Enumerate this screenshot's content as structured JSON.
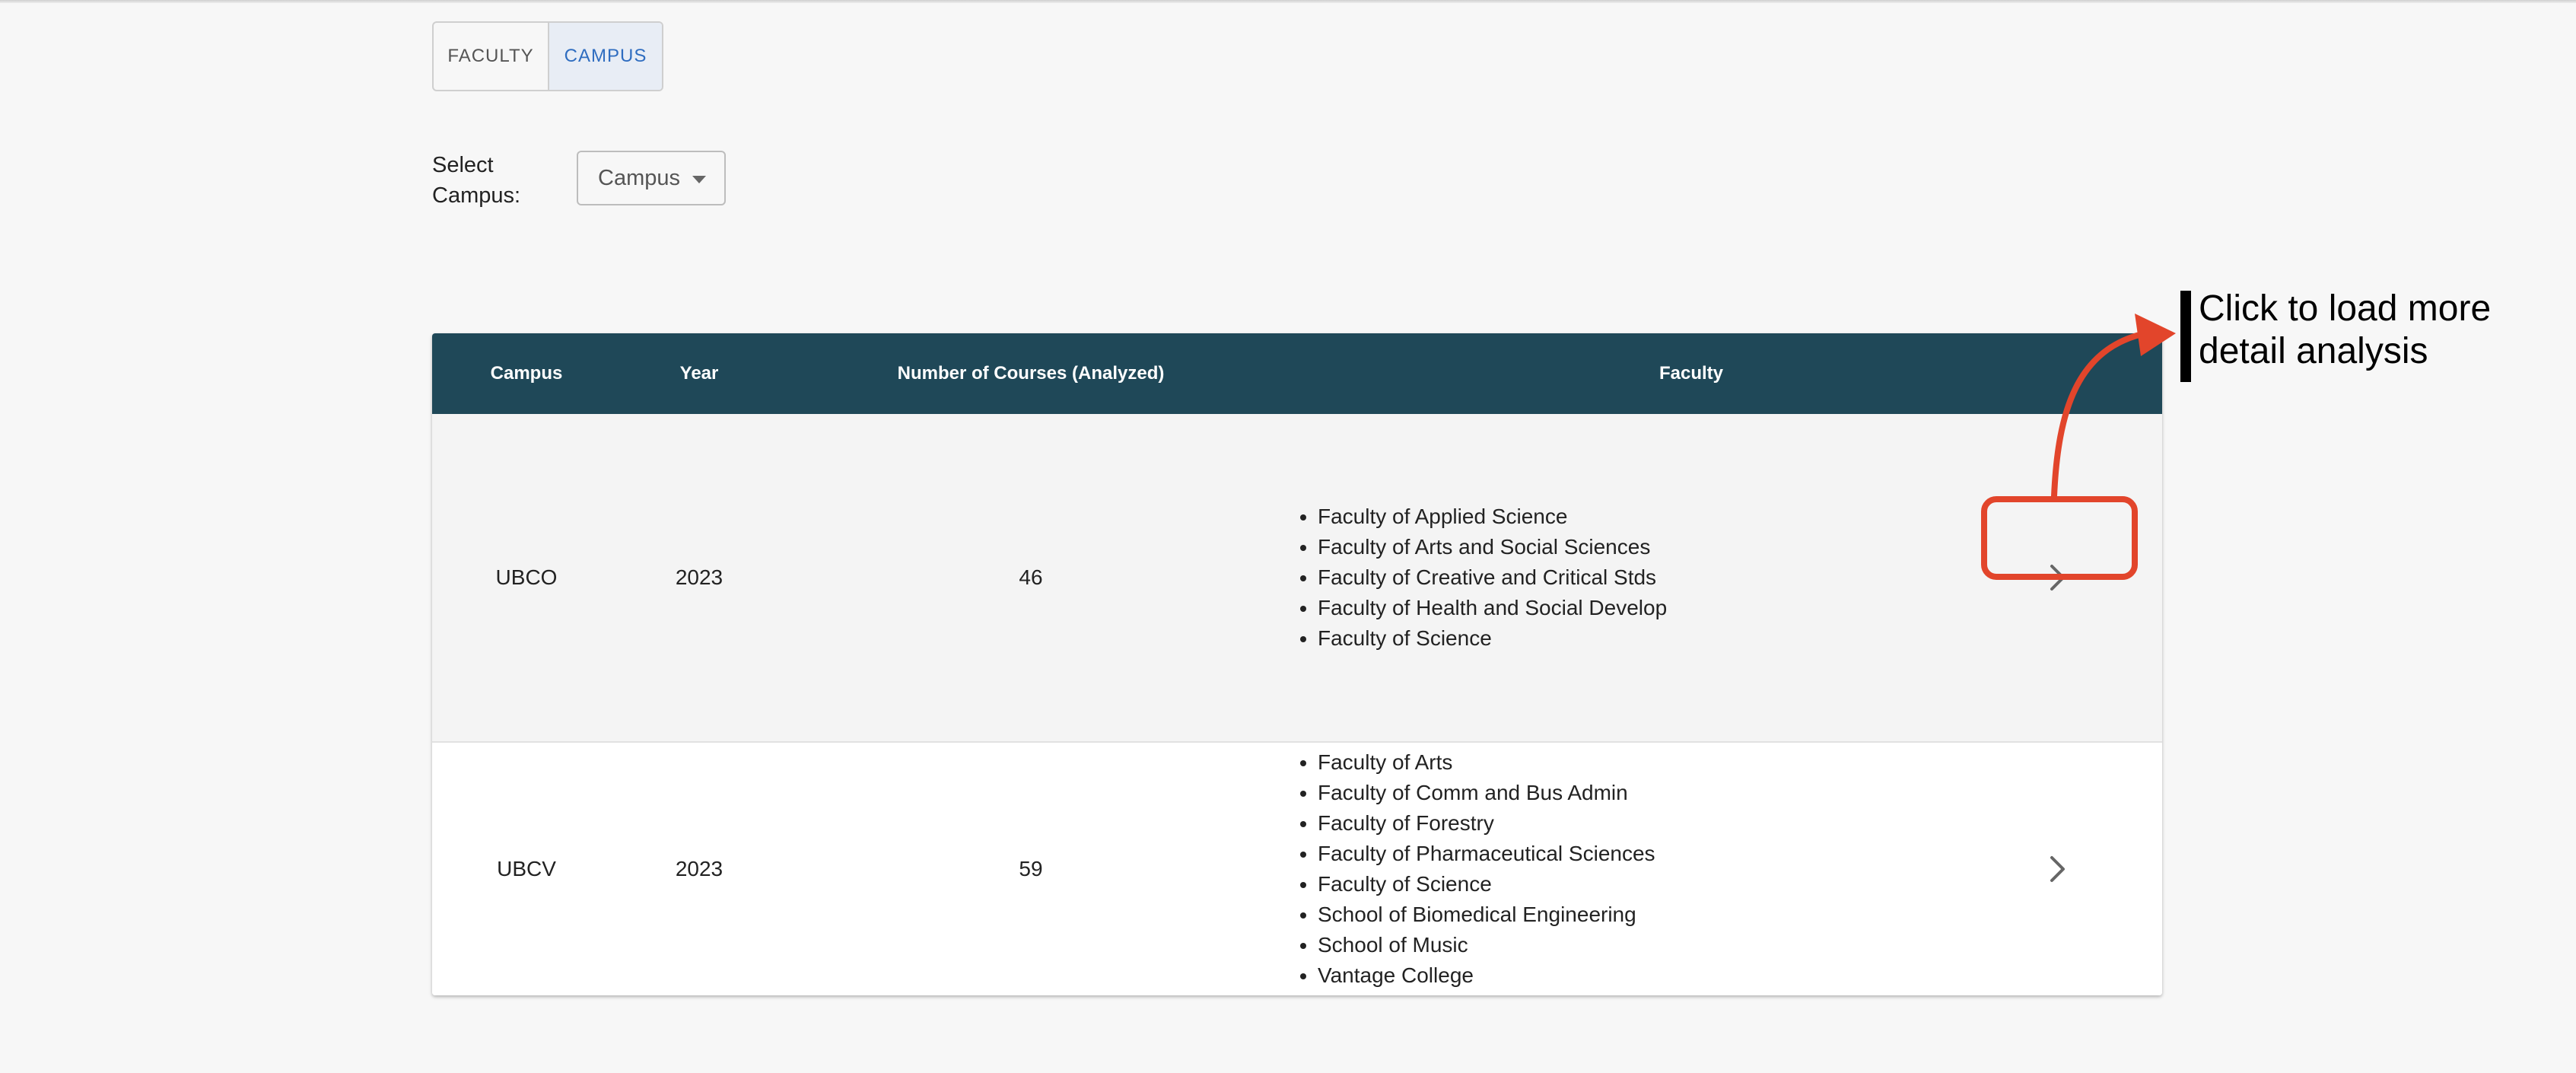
{
  "view_toggle": {
    "faculty_label": "FACULTY",
    "campus_label": "CAMPUS",
    "selected": "CAMPUS"
  },
  "filter": {
    "label": "Select Campus:",
    "select_value": "Campus"
  },
  "table": {
    "headers": {
      "campus": "Campus",
      "year": "Year",
      "courses": "Number of Courses (Analyzed)",
      "faculty": "Faculty"
    },
    "rows": [
      {
        "campus": "UBCO",
        "year": "2023",
        "courses": "46",
        "faculties": [
          "Faculty of Applied Science",
          "Faculty of Arts and Social Sciences",
          "Faculty of Creative and Critical Stds",
          "Faculty of Health and Social Develop",
          "Faculty of Science"
        ]
      },
      {
        "campus": "UBCV",
        "year": "2023",
        "courses": "59",
        "faculties": [
          "Faculty of Arts",
          "Faculty of Comm and Bus Admin",
          "Faculty of Forestry",
          "Faculty of Pharmaceutical Sciences",
          "Faculty of Science",
          "School of Biomedical Engineering",
          "School of Music",
          "Vantage College"
        ]
      }
    ]
  },
  "annotation": {
    "text": "Click to load more detail analysis",
    "color": "#e2452b"
  },
  "colors": {
    "header_bg": "#1f4858",
    "accent": "#2f6dc0"
  }
}
